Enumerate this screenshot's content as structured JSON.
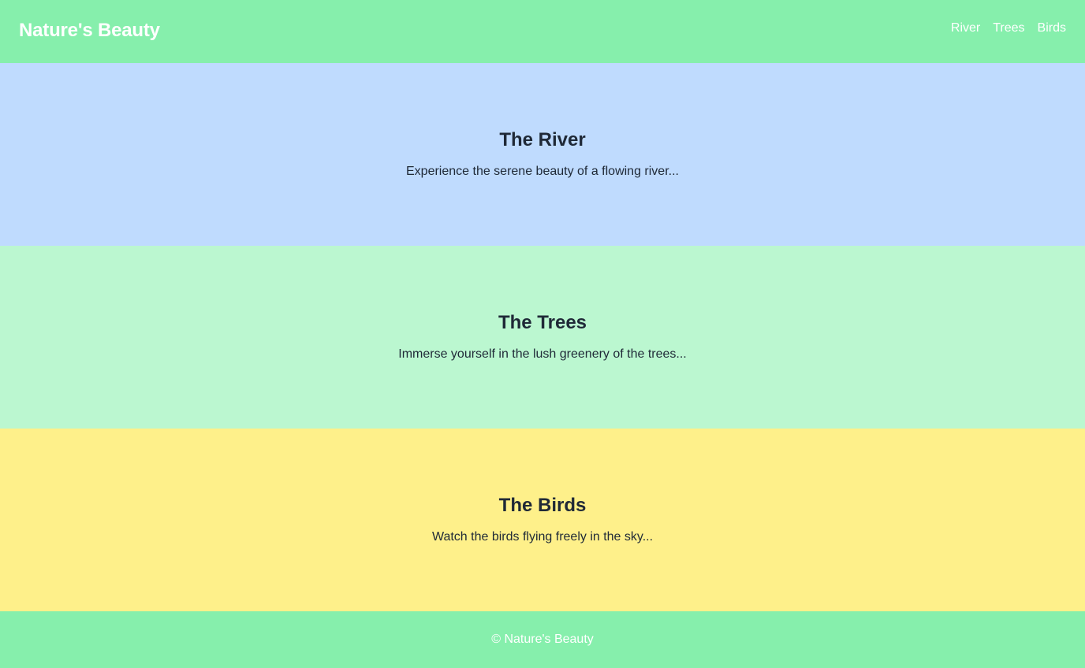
{
  "header": {
    "brand": "Nature's Beauty",
    "nav": [
      {
        "label": "River"
      },
      {
        "label": "Trees"
      },
      {
        "label": "Birds"
      }
    ]
  },
  "sections": [
    {
      "title": "The River",
      "text": "Experience the serene beauty of a flowing river..."
    },
    {
      "title": "The Trees",
      "text": "Immerse yourself in the lush greenery of the trees..."
    },
    {
      "title": "The Birds",
      "text": "Watch the birds flying freely in the sky..."
    }
  ],
  "footer": {
    "text": "© Nature's Beauty"
  },
  "colors": {
    "header_bg": "#86efac",
    "river_bg": "#bfdbfe",
    "trees_bg": "#bbf7d0",
    "birds_bg": "#fef08a",
    "text_dark": "#1f2937"
  }
}
